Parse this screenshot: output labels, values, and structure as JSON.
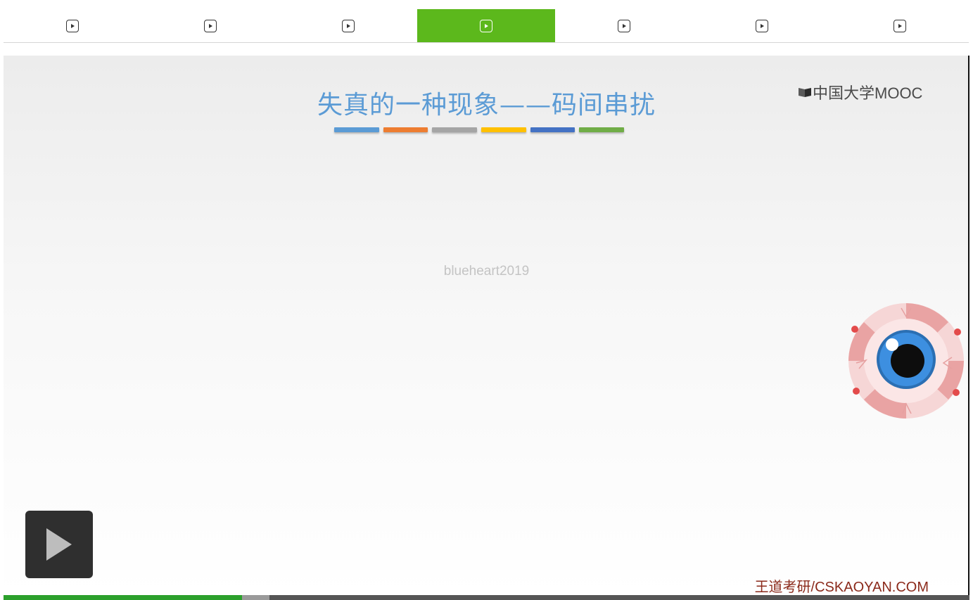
{
  "tabs": [
    {
      "icon": "video-play-icon",
      "active": false
    },
    {
      "icon": "video-play-icon",
      "active": false
    },
    {
      "icon": "video-play-icon",
      "active": false
    },
    {
      "icon": "video-play-icon",
      "active": true
    },
    {
      "icon": "video-play-icon",
      "active": false
    },
    {
      "icon": "video-play-icon",
      "active": false
    },
    {
      "icon": "video-play-icon",
      "active": false
    }
  ],
  "slide": {
    "title": "失真的一种现象——码间串扰",
    "title_color": "#5b9bd5",
    "title_bar_colors": [
      "#5b9bd5",
      "#ed7d31",
      "#a5a5a5",
      "#ffc000",
      "#4472c4",
      "#70ad47"
    ],
    "watermark": "blueheart2019",
    "logo_text": "中国大学MOOC",
    "footer_brand": "王道考研/CSKAOYAN.COM"
  },
  "player": {
    "play_icon": "play-icon",
    "played_fraction": 0.247,
    "buffered_fraction": 0.275,
    "accent_color": "#2ca02c",
    "active_tab_color": "#5cb81c"
  }
}
